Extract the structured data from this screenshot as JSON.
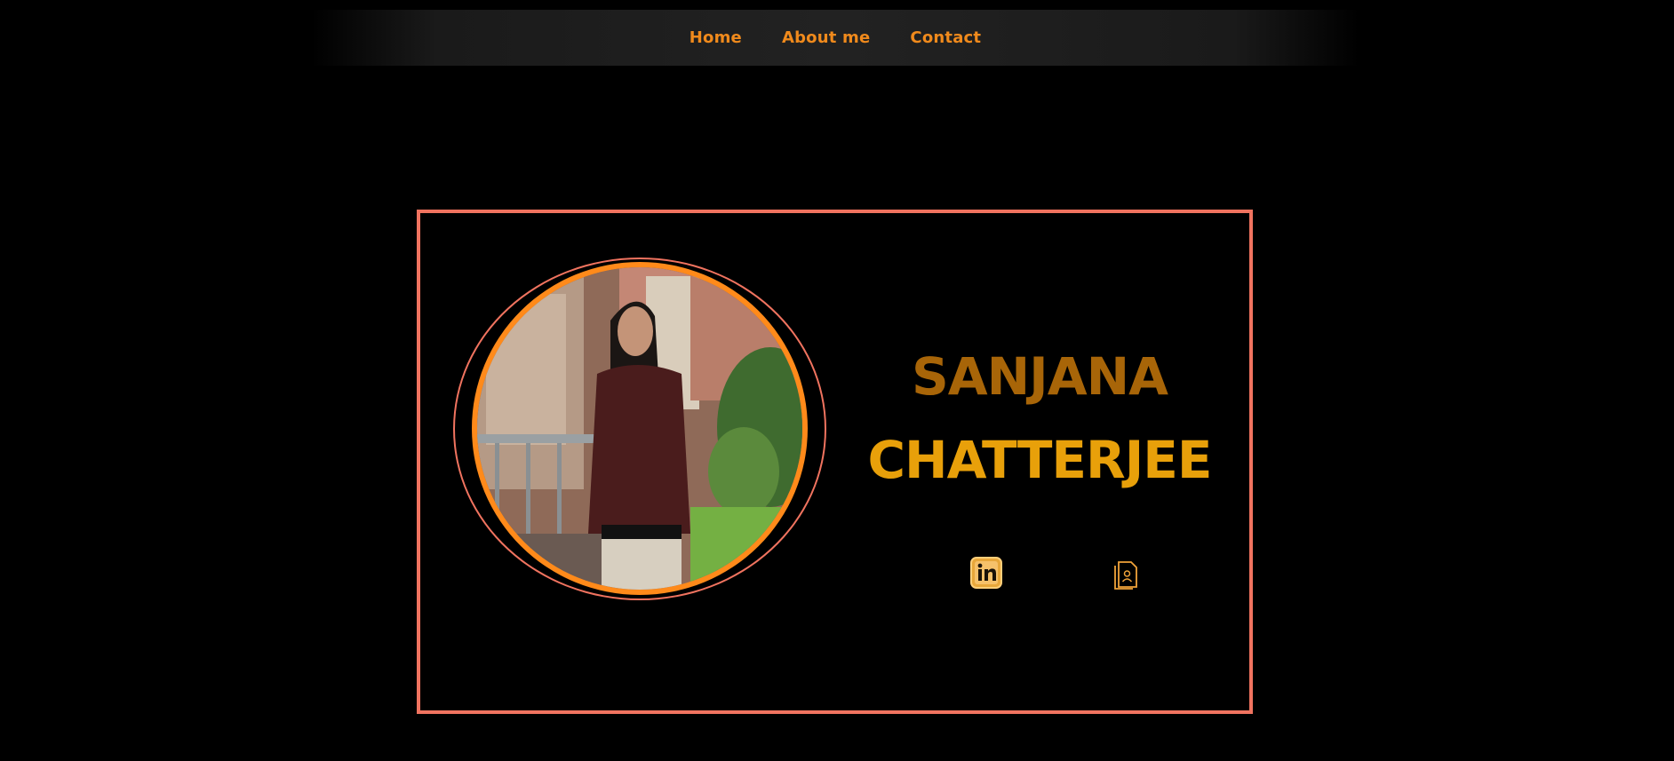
{
  "nav": {
    "items": [
      {
        "label": "Home"
      },
      {
        "label": "About me"
      },
      {
        "label": "Contact"
      }
    ]
  },
  "hero": {
    "first_name": "SANJANA",
    "last_name": "CHATTERJEE",
    "icons": [
      "linkedin-icon",
      "resume-icon"
    ]
  },
  "colors": {
    "background": "#000000",
    "accent_orange": "#f08a1c",
    "border_coral": "#f0735f",
    "name_dark_gold": "#a86508",
    "name_gold": "#e8a00a"
  }
}
